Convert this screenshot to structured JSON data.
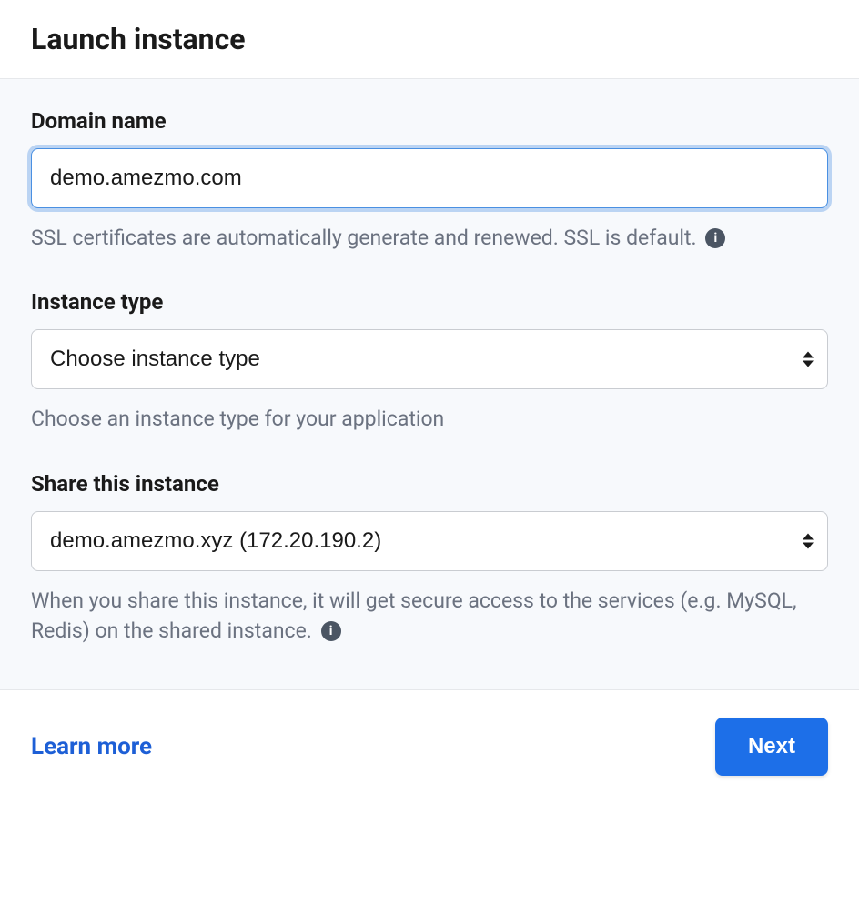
{
  "header": {
    "title": "Launch instance"
  },
  "fields": {
    "domain": {
      "label": "Domain name",
      "value": "demo.amezmo.com",
      "help": "SSL certificates are automatically generate and renewed. SSL is default."
    },
    "instance_type": {
      "label": "Instance type",
      "placeholder": "Choose instance type",
      "help": "Choose an instance type for your application"
    },
    "share": {
      "label": "Share this instance",
      "selected": "demo.amezmo.xyz (172.20.190.2)",
      "help": "When you share this instance, it will get secure access to the services (e.g. MySQL, Redis) on the shared instance."
    }
  },
  "footer": {
    "learn_more": "Learn more",
    "next": "Next"
  }
}
